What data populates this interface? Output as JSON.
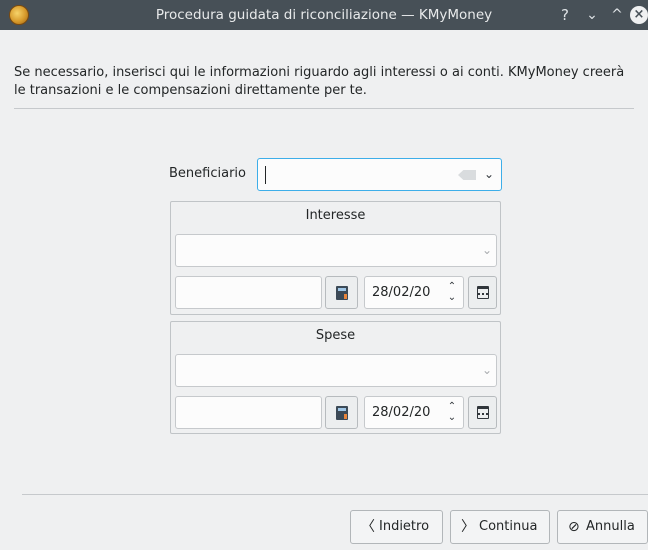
{
  "window": {
    "title": "Procedura guidata di riconciliazione — KMyMoney",
    "help_glyph": "?",
    "minimize_glyph": "⌄",
    "maximize_glyph": "^",
    "close_glyph": "×"
  },
  "intro": "Se necessario, inserisci qui le informazioni riguardo agli interessi o ai conti. KMyMoney creerà le transazioni e le compensazioni direttamente per te.",
  "payee": {
    "label": "Beneficiario",
    "value": ""
  },
  "interest": {
    "title": "Interesse",
    "category": "",
    "amount": "",
    "date": "28/02/20"
  },
  "charges": {
    "title": "Spese",
    "category": "",
    "amount": "",
    "date": "28/02/20"
  },
  "buttons": {
    "back": "Indietro",
    "next": "Continua",
    "cancel": "Annulla"
  },
  "icons": {
    "app": "kmymoney-icon",
    "clear": "clear-text-icon",
    "dropdown": "chevron-down-icon",
    "calculator": "calculator-icon",
    "calendar": "calendar-icon",
    "back": "chevron-left-icon",
    "next": "chevron-right-icon",
    "cancel": "cancel-icon"
  },
  "colors": {
    "titlebar": "#475057",
    "window_bg": "#eff0f1",
    "focus": "#3daee9"
  }
}
